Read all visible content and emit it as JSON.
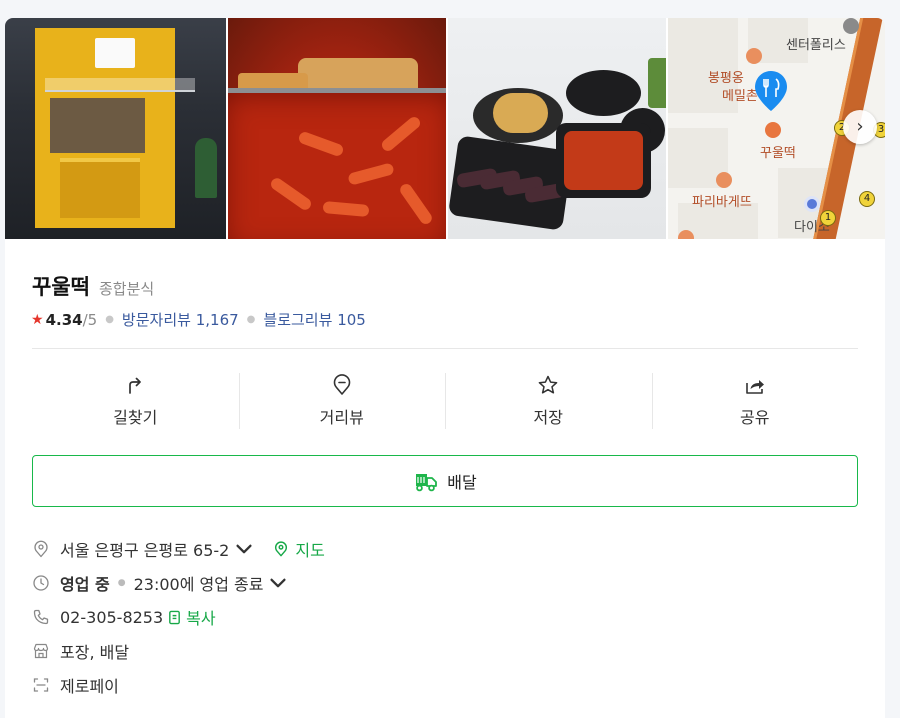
{
  "place": {
    "name": "꾸울떡",
    "category": "종합분식"
  },
  "rating": {
    "score": "4.34",
    "out_of": "/5",
    "visitor_reviews_label": "방문자리뷰",
    "visitor_reviews_count": "1,167",
    "blog_reviews_label": "블로그리뷰",
    "blog_reviews_count": "105"
  },
  "map": {
    "labels": {
      "center_police": "센터폴리스",
      "bongpyeong": "봉평옹",
      "memilcheon": "메밀촌",
      "kkuultteok": "꾸울떡",
      "paris_baguette": "파리바게뜨",
      "daiso": "다이소"
    },
    "station_numbers": [
      "1",
      "2",
      "3",
      "4"
    ]
  },
  "actions": [
    {
      "label": "길찾기",
      "icon": "directions-icon"
    },
    {
      "label": "거리뷰",
      "icon": "street-view-icon"
    },
    {
      "label": "저장",
      "icon": "star-icon"
    },
    {
      "label": "공유",
      "icon": "share-icon"
    }
  ],
  "delivery_button": {
    "label": "배달",
    "icon": "delivery-truck-icon"
  },
  "info": {
    "address": "서울 은평구 은평로 65-2",
    "map_link": "지도",
    "status": "영업 중",
    "hours": "23:00에 영업 종료",
    "phone": "02-305-8253",
    "copy": "복사",
    "services": "포장, 배달",
    "payment": "제로페이"
  },
  "colors": {
    "accent_green": "#17a848",
    "star_red": "#e5362c",
    "link_blue": "#3a5a9e",
    "pin_blue": "#1a8cf0"
  }
}
